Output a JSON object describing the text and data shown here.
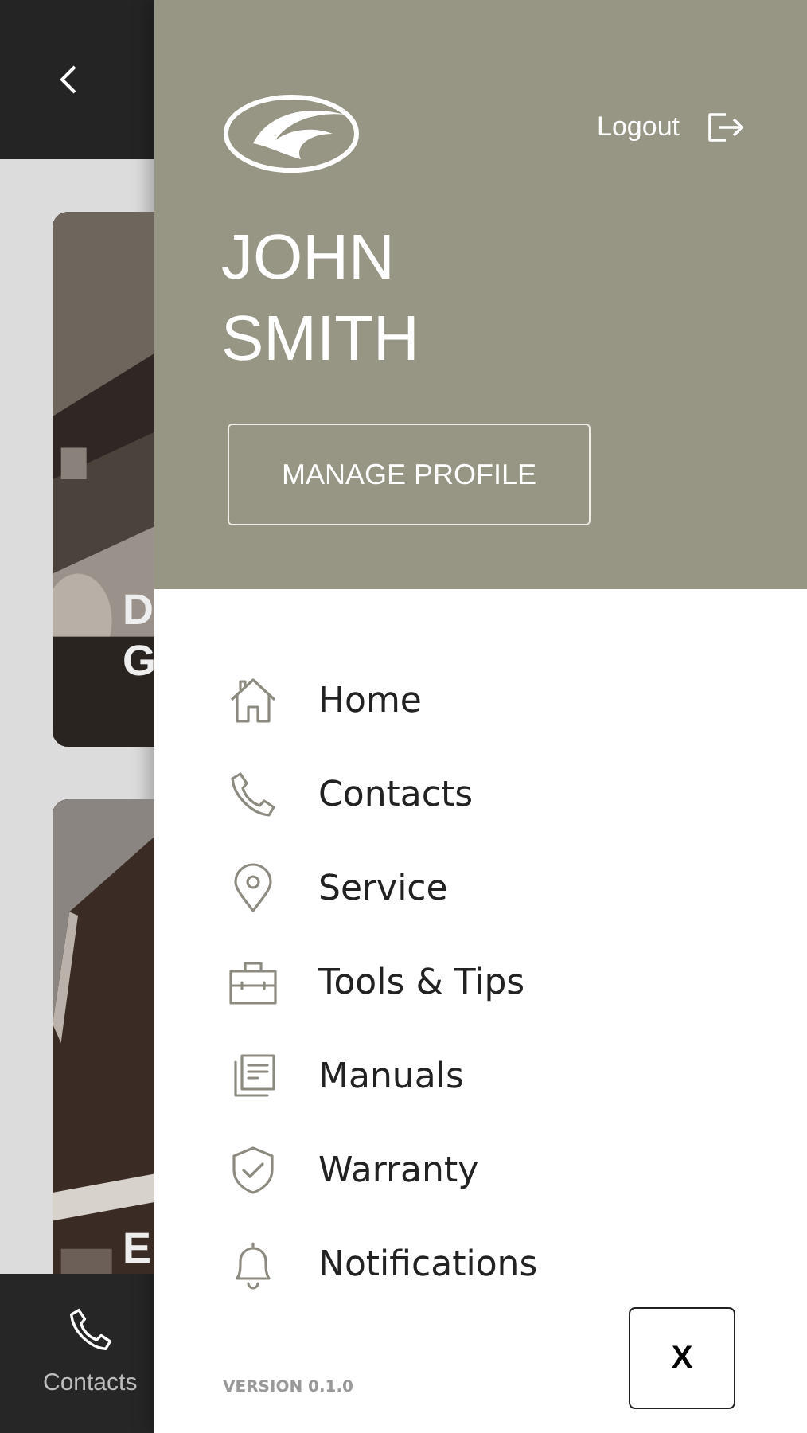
{
  "background": {
    "cards": [
      {
        "title_lines": [
          "D",
          "G"
        ]
      },
      {
        "title_lines": [
          "E"
        ]
      }
    ],
    "tab_bar": [
      {
        "label": "Contacts",
        "kind": "phone"
      }
    ]
  },
  "drawer": {
    "logout": "Logout",
    "user_name": [
      "JOHN",
      "SMITH"
    ],
    "manage_button": "MANAGE PROFILE",
    "menu": [
      {
        "label": "Home",
        "kind": "home"
      },
      {
        "label": "Contacts",
        "kind": "phone"
      },
      {
        "label": "Service",
        "kind": "pin"
      },
      {
        "label": "Tools & Tips",
        "kind": "toolbox"
      },
      {
        "label": "Manuals",
        "kind": "docs"
      },
      {
        "label": "Warranty",
        "kind": "shield"
      },
      {
        "label": "Notifications",
        "kind": "bell"
      }
    ],
    "version": "VERSION 0.1.0",
    "close_button": "X"
  }
}
